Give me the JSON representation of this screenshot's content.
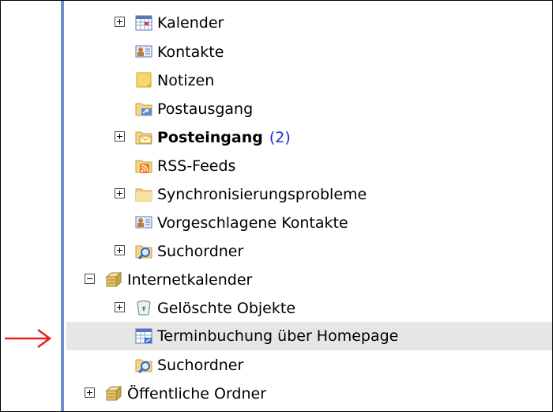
{
  "folders": [
    {
      "label": "Kalender",
      "icon": "calendar-icon",
      "expander": "plus"
    },
    {
      "label": "Kontakte",
      "icon": "contacts-icon"
    },
    {
      "label": "Notizen",
      "icon": "notes-icon"
    },
    {
      "label": "Postausgang",
      "icon": "outbox-icon"
    },
    {
      "label": "Posteingang",
      "icon": "inbox-icon",
      "expander": "plus",
      "bold": true,
      "count": "(2)"
    },
    {
      "label": "RSS-Feeds",
      "icon": "rss-icon"
    },
    {
      "label": "Synchronisierungsprobleme",
      "icon": "folder-icon",
      "expander": "plus"
    },
    {
      "label": "Vorgeschlagene Kontakte",
      "icon": "contacts-icon"
    },
    {
      "label": "Suchordner",
      "icon": "search-folder-icon",
      "expander": "plus"
    },
    {
      "label": "Internetkalender",
      "icon": "mailbox-icon",
      "expander": "minus"
    },
    {
      "label": "Gelöschte Objekte",
      "icon": "deleted-items-icon",
      "expander": "plus"
    },
    {
      "label": "Terminbuchung über Homepage",
      "icon": "shared-calendar-icon",
      "selected": true
    },
    {
      "label": "Suchordner",
      "icon": "search-folder-icon"
    },
    {
      "label": "Öffentliche Ordner",
      "icon": "mailbox-icon",
      "expander": "plus"
    }
  ],
  "colors": {
    "accent_bar": "#6f90c8",
    "unread_count": "#1a2bd6",
    "selection": "#e6e6e6",
    "arrow": "#e8201d"
  }
}
